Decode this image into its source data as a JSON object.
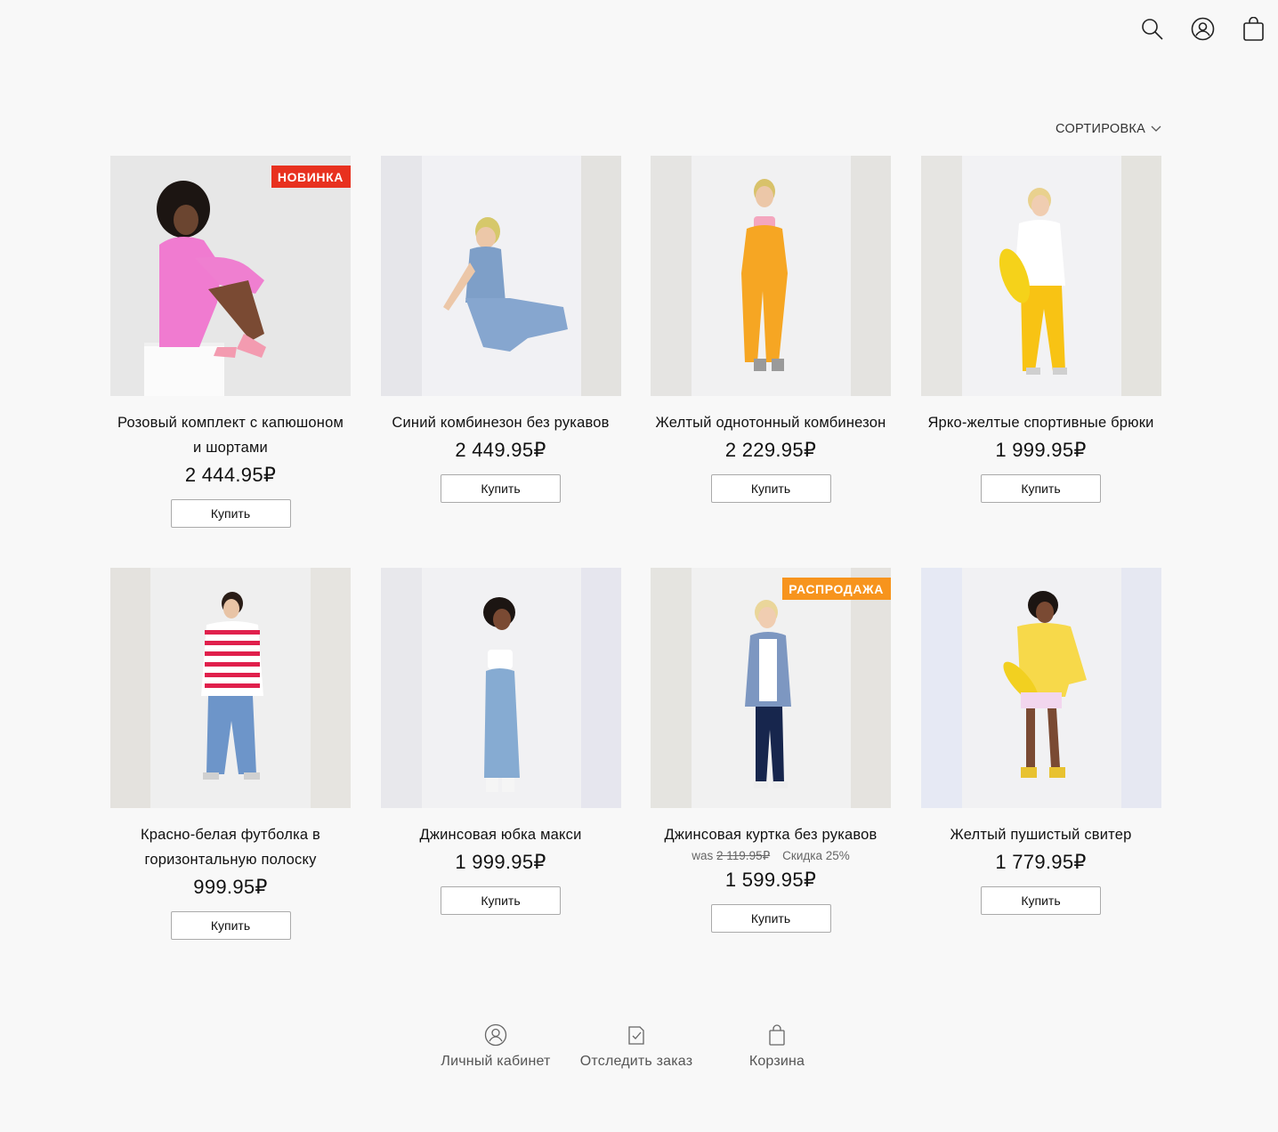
{
  "header": {
    "icons": [
      "search-icon",
      "account-icon",
      "bag-icon"
    ]
  },
  "sort": {
    "label": "СОРТИРОВКА"
  },
  "products": [
    {
      "title": "Розовый комплект с капюшоном и шортами",
      "price": "2 444.95₽",
      "badge": "НОВИНКА",
      "badge_color": "#e8311f",
      "buy": "Купить"
    },
    {
      "title": "Синий комбинезон без рукавов",
      "price": "2 449.95₽",
      "buy": "Купить"
    },
    {
      "title": "Желтый однотонный комбинезон",
      "price": "2 229.95₽",
      "buy": "Купить"
    },
    {
      "title": "Ярко-желтые спортивные брюки",
      "price": "1 999.95₽",
      "buy": "Купить"
    },
    {
      "title": "Красно-белая футболка в горизонтальную полоску",
      "price": "999.95₽",
      "buy": "Купить"
    },
    {
      "title": "Джинсовая юбка макси",
      "price": "1 999.95₽",
      "buy": "Купить"
    },
    {
      "title": "Джинсовая куртка без рукавов",
      "price": "1 599.95₽",
      "was_prefix": "was",
      "was_price": "2 119.95₽",
      "discount": "Скидка 25%",
      "badge": "РАСПРОДАЖА",
      "badge_color": "#f7941d",
      "buy": "Купить"
    },
    {
      "title": "Желтый пушистый свитер",
      "price": "1 779.95₽",
      "buy": "Купить"
    }
  ],
  "footer": {
    "items": [
      {
        "label": "Личный кабинет",
        "icon": "account-icon"
      },
      {
        "label": "Отследить заказ",
        "icon": "track-order-icon"
      },
      {
        "label": "Корзина",
        "icon": "bag-icon"
      }
    ]
  }
}
